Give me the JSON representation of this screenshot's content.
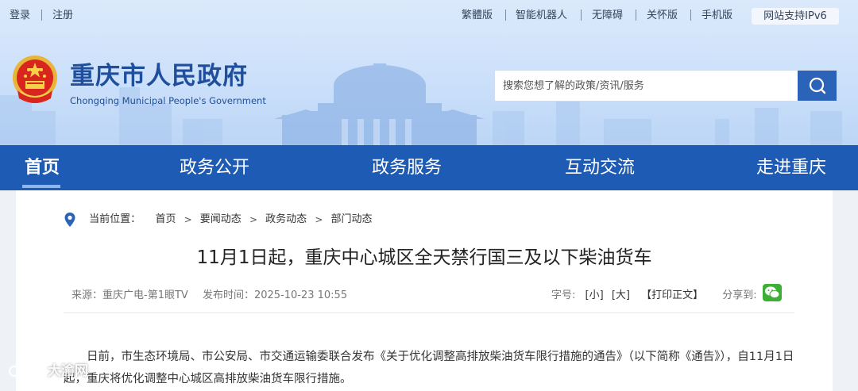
{
  "topbar": {
    "login": "登录",
    "register": "注册",
    "links": [
      "繁體版",
      "智能机器人",
      "无障碍",
      "关怀版",
      "手机版"
    ],
    "ipv6": "网站支持IPv6"
  },
  "site": {
    "title": "重庆市人民政府",
    "subtitle": "Chongqing Municipal People's Government"
  },
  "search": {
    "placeholder": "搜索您想了解的政策/资讯/服务"
  },
  "nav": {
    "items": [
      "首页",
      "政务公开",
      "政务服务",
      "互动交流",
      "走进重庆"
    ],
    "active_index": 0
  },
  "breadcrumb": {
    "label": "当前位置：",
    "items": [
      "首页",
      "要闻动态",
      "政务动态",
      "部门动态"
    ],
    "separator": ">"
  },
  "article": {
    "title": "11月1日起，重庆中心城区全天禁行国三及以下柴油货车",
    "source_label": "来源：重庆广电-第1眼TV",
    "publish_time_label": "发布时间：2025-10-23 10:55",
    "font_size_label": "字号:",
    "font_small": "[小]",
    "font_large": "[大]",
    "print_label": "【打印正文】",
    "share_label": "分享到:",
    "paragraph": "日前，市生态环境局、市公安局、市交通运输委联合发布《关于优化调整高排放柴油货车限行措施的通告》（以下简称《通告》），自11月1日起，重庆将优化调整中心城区高排放柴油货车限行措施。"
  },
  "watermark": {
    "text": "大渝网"
  },
  "colors": {
    "nav_bg": "#1d5bb4",
    "title_blue": "#1f4f9c",
    "search_button": "#2a63b7",
    "wechat_green": "#3cb034"
  },
  "icons": {
    "search": "search-icon",
    "location": "location-pin-icon",
    "share": "wechat-icon",
    "emblem": "national-emblem-icon"
  }
}
